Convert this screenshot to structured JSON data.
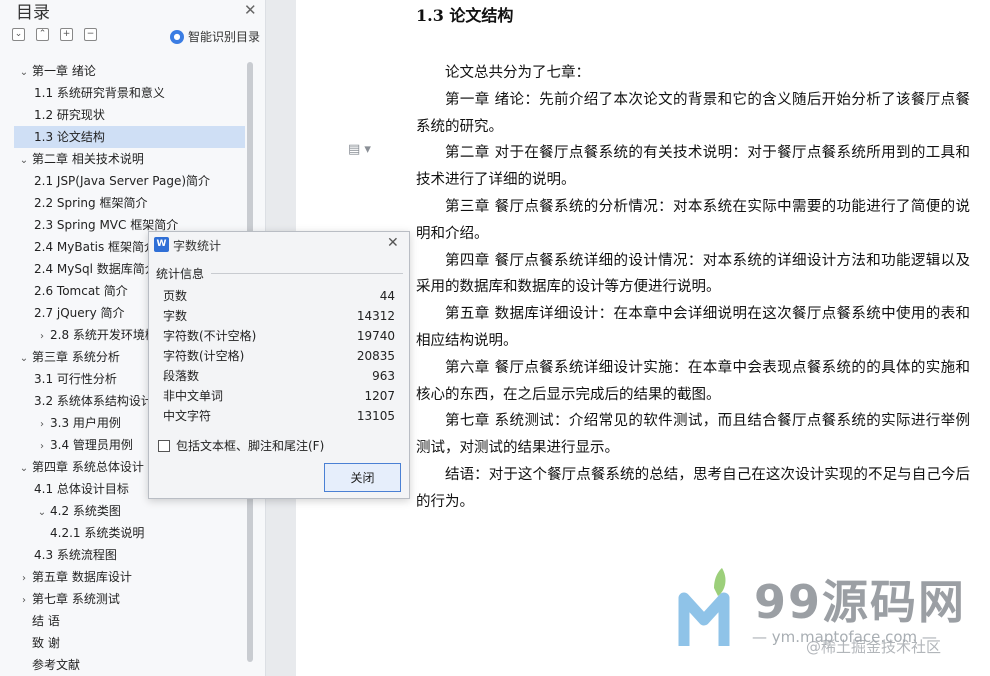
{
  "toc": {
    "title": "目录",
    "smart_toc_label": "智能识别目录",
    "toolbar": [
      "expand-all",
      "collapse-all",
      "add-level",
      "remove-level"
    ],
    "items": [
      {
        "label": "第一章   绪论",
        "expanded": true
      },
      {
        "label": "1.1 系统研究背景和意义"
      },
      {
        "label": "1.2 研究现状"
      },
      {
        "label": "1.3 论文结构",
        "active": true
      },
      {
        "label": "第二章   相关技术说明",
        "expanded": true
      },
      {
        "label": "2.1 JSP(Java Server Page)简介"
      },
      {
        "label": "2.2 Spring 框架简介"
      },
      {
        "label": "2.3 Spring MVC 框架简介"
      },
      {
        "label": "2.4 MyBatis  框架简介"
      },
      {
        "label": "2.4 MySql 数据库简介"
      },
      {
        "label": "2.6 Tomcat 简介"
      },
      {
        "label": "2.7 jQuery 简介"
      },
      {
        "label": "2.8 系统开发环境概述",
        "expanded": false
      },
      {
        "label": "第三章   系统分析",
        "expanded": true
      },
      {
        "label": "3.1 可行性分析"
      },
      {
        "label": "3.2 系统体系结构设计"
      },
      {
        "label": "3.3 用户用例",
        "expanded": false
      },
      {
        "label": "3.4 管理员用例",
        "expanded": false
      },
      {
        "label": "第四章   系统总体设计",
        "expanded": true
      },
      {
        "label": "4.1 总体设计目标"
      },
      {
        "label": "4.2 系统类图",
        "expanded": true
      },
      {
        "label": "4.2.1 系统类说明"
      },
      {
        "label": "4.3 系统流程图"
      },
      {
        "label": "第五章   数据库设计",
        "expanded": false
      },
      {
        "label": "第七章   系统测试",
        "expanded": false
      },
      {
        "label": "结   语"
      },
      {
        "label": "致   谢"
      },
      {
        "label": "参考文献"
      }
    ]
  },
  "document": {
    "heading": "1.3 论文结构",
    "paragraphs": [
      "论文总共分为了七章：",
      "第一章 绪论：先前介绍了本次论文的背景和它的含义随后开始分析了该餐厅点餐系统的研究。",
      "第二章 对于在餐厅点餐系统的有关技术说明：对于餐厅点餐系统所用到的工具和技术进行了详细的说明。",
      "第三章 餐厅点餐系统的分析情况：对本系统在实际中需要的功能进行了简便的说明和介绍。",
      "第四章 餐厅点餐系统详细的设计情况：对本系统的详细设计方法和功能逻辑以及采用的数据库和数据库的设计等方便进行说明。",
      "第五章 数据库详细设计：在本章中会详细说明在这次餐厅点餐系统中使用的表和相应结构说明。",
      "第六章 餐厅点餐系统详细设计实施：在本章中会表现点餐系统的的具体的实施和核心的东西，在之后显示完成后的结果的截图。",
      "第七章 系统测试：介绍常见的软件测试，而且结合餐厅点餐系统的实际进行举例测试，对测试的结果进行显示。",
      "结语：对于这个餐厅点餐系统的总结，思考自己在这次设计实现的不足与自己今后的行为。"
    ]
  },
  "word_count_dialog": {
    "title": "字数统计",
    "group_label": "统计信息",
    "stats": [
      {
        "label": "页数",
        "value": "44"
      },
      {
        "label": "字数",
        "value": "14312"
      },
      {
        "label": "字符数(不计空格)",
        "value": "19740"
      },
      {
        "label": "字符数(计空格)",
        "value": "20835"
      },
      {
        "label": "段落数",
        "value": "963"
      },
      {
        "label": "非中文单词",
        "value": "1207"
      },
      {
        "label": "中文字符",
        "value": "13105"
      }
    ],
    "include_checkbox_label": "包括文本框、脚注和尾注(F)",
    "include_checked": false,
    "close_button": "关闭"
  },
  "watermark": {
    "brand": "99源码网",
    "url": "— ym.maptoface.com —",
    "community": "@稀土掘金技术社区"
  },
  "colors": {
    "accent": "#2f6fd6",
    "toc_active_bg": "#cfdff5"
  }
}
